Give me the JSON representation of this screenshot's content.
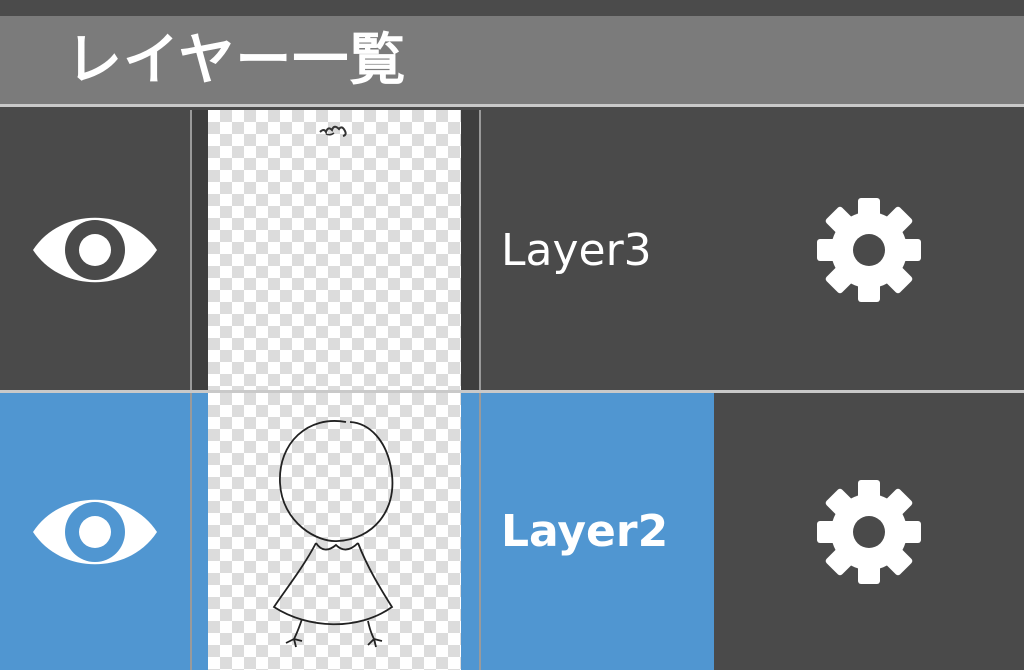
{
  "header": {
    "title": "レイヤー一覧"
  },
  "layers": [
    {
      "name": "Layer3",
      "selected": false,
      "visible": true
    },
    {
      "name": "Layer2",
      "selected": true,
      "visible": true
    }
  ],
  "colors": {
    "header_bg": "#7b7b7b",
    "row_bg": "#4a4a4a",
    "selected_bg": "#5096d1",
    "icon_fill": "#ffffff"
  },
  "icons": {
    "visibility": "eye-icon",
    "settings": "gear-icon"
  }
}
